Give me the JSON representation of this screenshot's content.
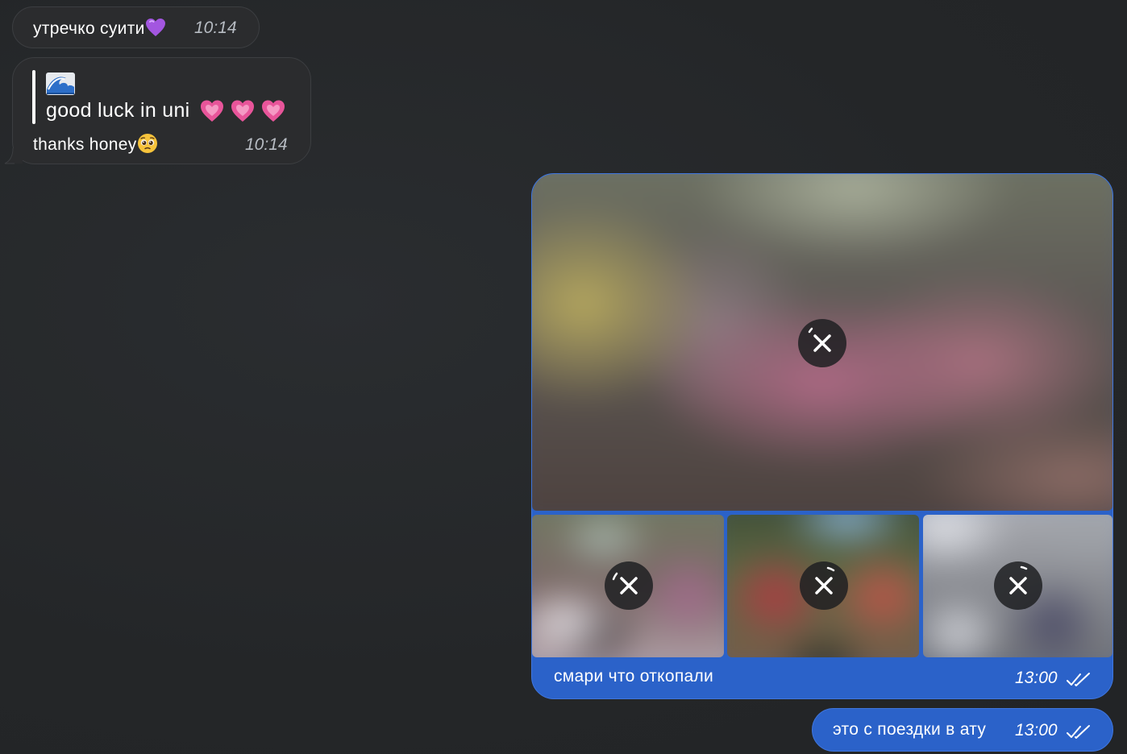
{
  "messages": [
    {
      "direction": "incoming",
      "text": "утречко суити",
      "emoji": "purple-heart",
      "time": "10:14"
    },
    {
      "direction": "incoming",
      "quote": {
        "emoji": "wave",
        "text": "good luck in uni",
        "emojis": [
          "pink-heart",
          "pink-heart",
          "pink-heart"
        ]
      },
      "text": "thanks honey",
      "emoji": "pleading-face",
      "time": "10:14"
    },
    {
      "direction": "outgoing",
      "type": "album",
      "photos": [
        {
          "status": "loading",
          "icon": "cancel-download-icon"
        },
        {
          "status": "loading",
          "icon": "cancel-download-icon"
        },
        {
          "status": "loading",
          "icon": "cancel-download-icon"
        },
        {
          "status": "loading",
          "icon": "cancel-download-icon"
        }
      ],
      "caption": "смари что откопали",
      "time": "13:00",
      "read_status": "double-check-icon"
    },
    {
      "direction": "outgoing",
      "text": "это с поездки в ату",
      "time": "13:00",
      "read_status": "double-check-icon"
    }
  ],
  "colors": {
    "background": "#25282a",
    "incoming_bubble": "#2b2c2e",
    "outgoing_bubble": "#2b62c9",
    "text": "#ffffff",
    "incoming_time": "#b7bcc3"
  }
}
